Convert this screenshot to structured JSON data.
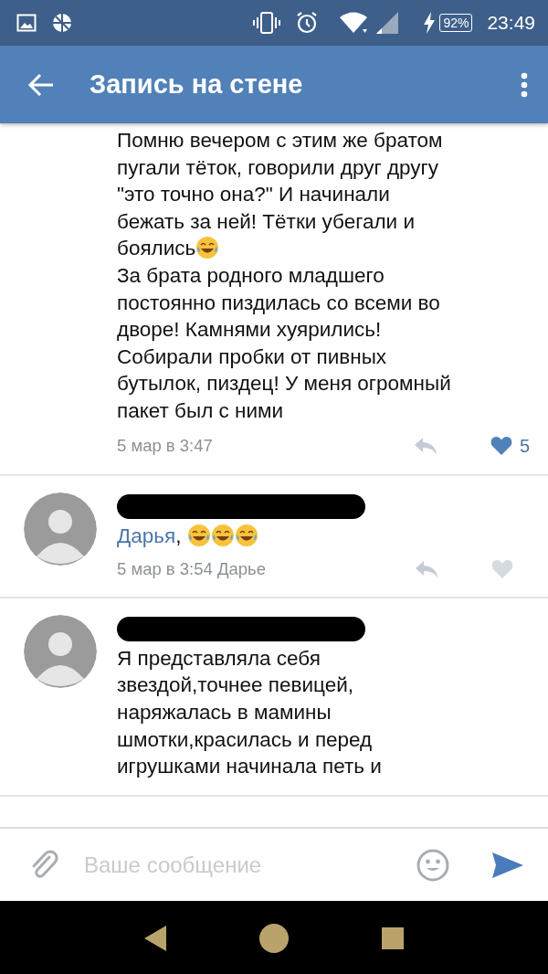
{
  "status_bar": {
    "battery": "92%",
    "time": "23:49"
  },
  "app_bar": {
    "title": "Запись на стене"
  },
  "comments": [
    {
      "avatar": false,
      "name_redacted": false,
      "body": [
        {
          "kind": "text",
          "text": "Помню вечером с этим же братом\nпугали тёток, говорили друг другу\n\"это точно она?\" И начинали\nбежать за ней! Тётки убегали и\nбоялись"
        },
        {
          "kind": "emoji"
        },
        {
          "kind": "text",
          "text": "\nЗа брата родного младшего\nпостоянно пиздилась со всеми во\nдворе! Камнями хуярились!\nСобирали пробки от пивных\nбутылок, пиздец! У меня огромный\nпакет был с ними"
        }
      ],
      "meta": "5 мар в 3:47",
      "liked": true,
      "likes": "5"
    },
    {
      "avatar": true,
      "name_redacted": true,
      "body": [
        {
          "kind": "mention",
          "text": "Дарья"
        },
        {
          "kind": "text",
          "text": ", "
        },
        {
          "kind": "emoji"
        },
        {
          "kind": "emoji"
        },
        {
          "kind": "emoji"
        }
      ],
      "meta": "5 мар в 3:54 Дарье",
      "liked": false
    },
    {
      "avatar": true,
      "name_redacted": true,
      "body": [
        {
          "kind": "text",
          "text": "Я представляла себя\nзвездой,точнее певицей,\nнаряжалась в мамины\nшмотки,красилась и перед\nигрушками начинала петь и"
        }
      ]
    }
  ],
  "composer": {
    "placeholder": "Ваше сообщение"
  }
}
